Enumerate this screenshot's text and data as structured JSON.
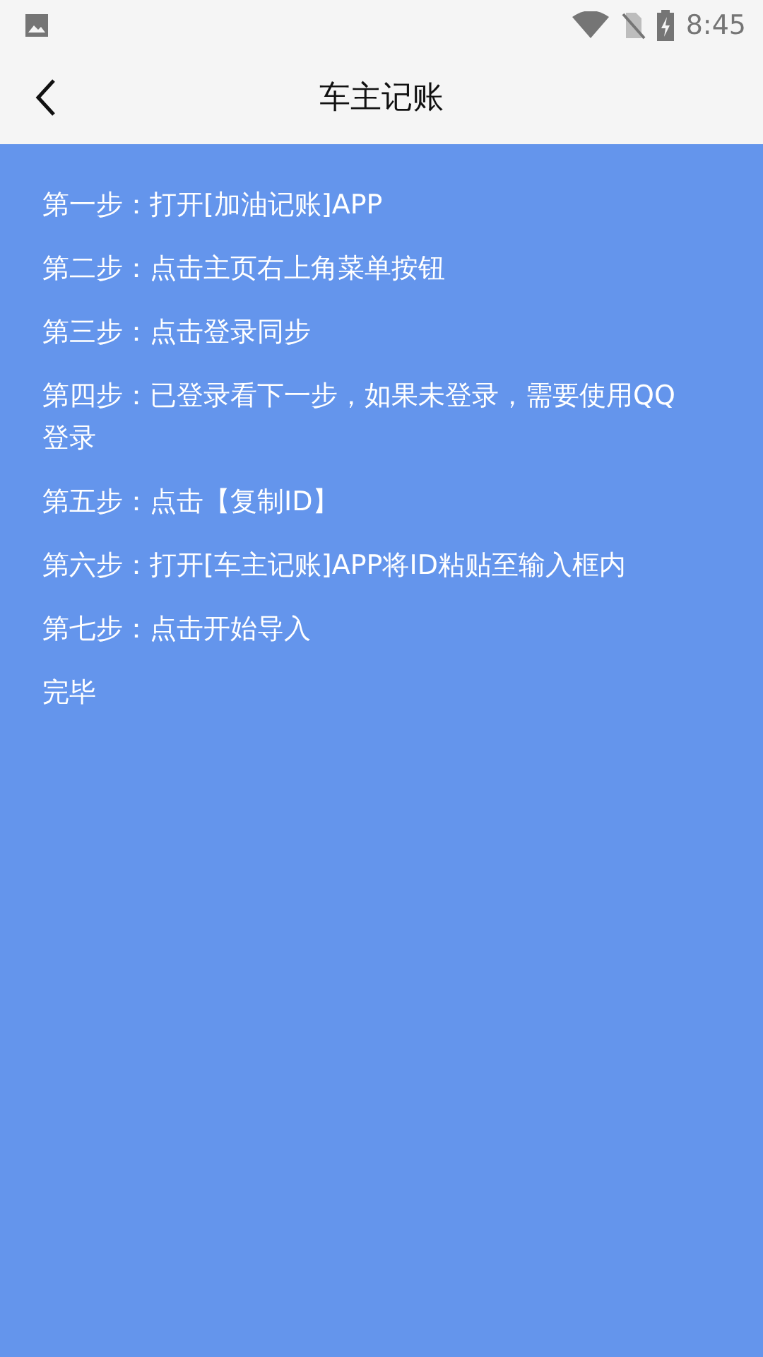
{
  "status_bar": {
    "time": "8:45"
  },
  "header": {
    "title": "车主记账"
  },
  "steps": [
    "第一步：打开[加油记账]APP",
    "第二步：点击主页右上角菜单按钮",
    "第三步：点击登录同步",
    "第四步：已登录看下一步，如果未登录，需要使用QQ登录",
    "第五步：点击【复制ID】",
    "第六步：打开[车主记账]APP将ID粘贴至输入框内",
    "第七步：点击开始导入",
    "完毕"
  ]
}
